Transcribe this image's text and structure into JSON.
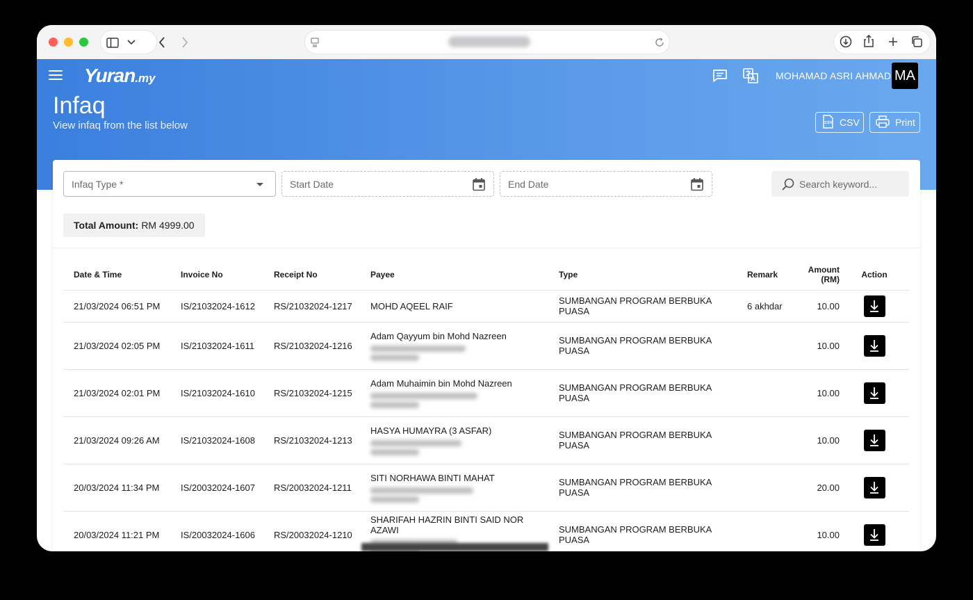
{
  "browser": {
    "back_icon": "chevron-left-icon",
    "forward_icon": "chevron-right-icon"
  },
  "header": {
    "logo_main": "Yuran",
    "logo_suffix": ".my",
    "user_name": "MOHAMAD ASRI AHMAD",
    "avatar_initials": "MA",
    "page_title": "Infaq",
    "page_subtitle": "View infaq from the list below",
    "csv_label": "CSV",
    "print_label": "Print",
    "accent_color": "#4a8ce5"
  },
  "filters": {
    "infaq_type_placeholder": "Infaq Type *",
    "start_date_placeholder": "Start Date",
    "end_date_placeholder": "End Date",
    "search_placeholder": "Search keyword..."
  },
  "summary": {
    "total_label": "Total Amount:",
    "total_value": "RM 4999.00"
  },
  "table": {
    "columns": [
      "Date & Time",
      "Invoice No",
      "Receipt No",
      "Payee",
      "Type",
      "Remark",
      "Amount (RM)",
      "Action"
    ],
    "rows": [
      {
        "datetime": "21/03/2024 06:51 PM",
        "invoice": "IS/21032024-1612",
        "receipt": "RS/21032024-1217",
        "payee": "MOHD AQEEL RAIF",
        "type": "SUMBANGAN PROGRAM BERBUKA PUASA",
        "remark": "6 akhdar",
        "amount": "10.00"
      },
      {
        "datetime": "21/03/2024 02:05 PM",
        "invoice": "IS/21032024-1611",
        "receipt": "RS/21032024-1216",
        "payee": "Adam Qayyum bin Mohd Nazreen",
        "type": "SUMBANGAN PROGRAM BERBUKA PUASA",
        "remark": "",
        "amount": "10.00"
      },
      {
        "datetime": "21/03/2024 02:01 PM",
        "invoice": "IS/21032024-1610",
        "receipt": "RS/21032024-1215",
        "payee": "Adam Muhaimin bin Mohd Nazreen",
        "type": "SUMBANGAN PROGRAM BERBUKA PUASA",
        "remark": "",
        "amount": "10.00"
      },
      {
        "datetime": "21/03/2024 09:26 AM",
        "invoice": "IS/21032024-1608",
        "receipt": "RS/21032024-1213",
        "payee": "HASYA HUMAYRA (3 ASFAR)",
        "type": "SUMBANGAN PROGRAM BERBUKA PUASA",
        "remark": "",
        "amount": "10.00"
      },
      {
        "datetime": "20/03/2024 11:34 PM",
        "invoice": "IS/20032024-1607",
        "receipt": "RS/20032024-1211",
        "payee": "SITI NORHAWA BINTI MAHAT",
        "type": "SUMBANGAN PROGRAM BERBUKA PUASA",
        "remark": "",
        "amount": "20.00"
      },
      {
        "datetime": "20/03/2024 11:21 PM",
        "invoice": "IS/20032024-1606",
        "receipt": "RS/20032024-1210",
        "payee": "SHARIFAH HAZRIN BINTI SAID NOR AZAWI",
        "type": "SUMBANGAN PROGRAM BERBUKA PUASA",
        "remark": "",
        "amount": "10.00"
      }
    ]
  }
}
